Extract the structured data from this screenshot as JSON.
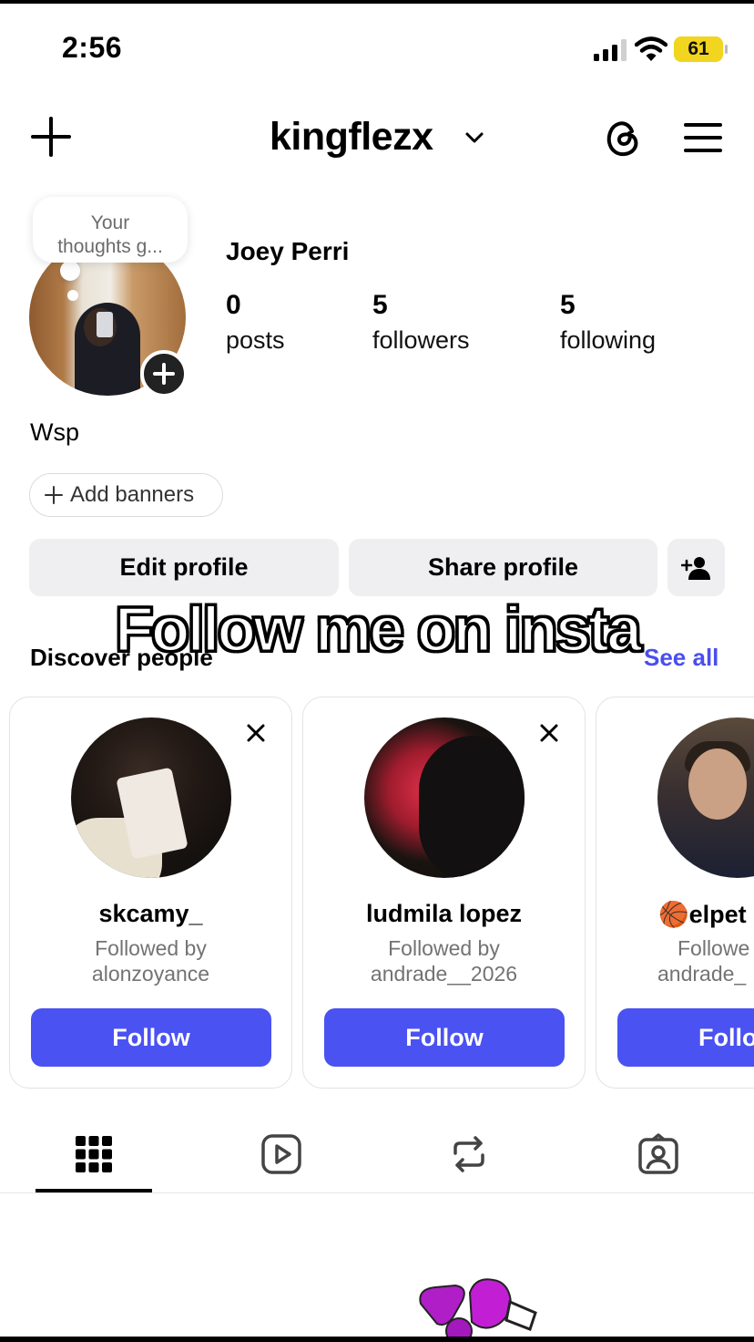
{
  "status_bar": {
    "time": "2:56",
    "battery": "61"
  },
  "header": {
    "username": "kingflezx"
  },
  "profile": {
    "thought_bubble": "Your thoughts g...",
    "full_name": "Joey Perri",
    "stats": [
      {
        "value": "0",
        "label": "posts"
      },
      {
        "value": "5",
        "label": "followers"
      },
      {
        "value": "5",
        "label": "following"
      }
    ],
    "bio": "Wsp",
    "add_banners": "Add banners"
  },
  "actions": {
    "edit": "Edit profile",
    "share": "Share profile"
  },
  "caption": "Follow me on insta",
  "discover": {
    "title": "Discover people",
    "see_all": "See all",
    "cards": [
      {
        "name": "skcamy_",
        "sub1": "Followed by",
        "sub2": "alonzoyance",
        "button": "Follow"
      },
      {
        "name": "ludmila lopez",
        "sub1": "Followed by",
        "sub2": "andrade__2026",
        "button": "Follow"
      },
      {
        "name": "🏀elpet",
        "sub1": "Followe",
        "sub2": "andrade_",
        "button": "Follo"
      }
    ]
  },
  "tabs": [
    "grid-icon",
    "reels-icon",
    "reposts-icon",
    "tagged-icon"
  ],
  "colors": {
    "accent": "#4a52f2",
    "link": "#4a4ef0",
    "battery": "#f2d51e"
  }
}
